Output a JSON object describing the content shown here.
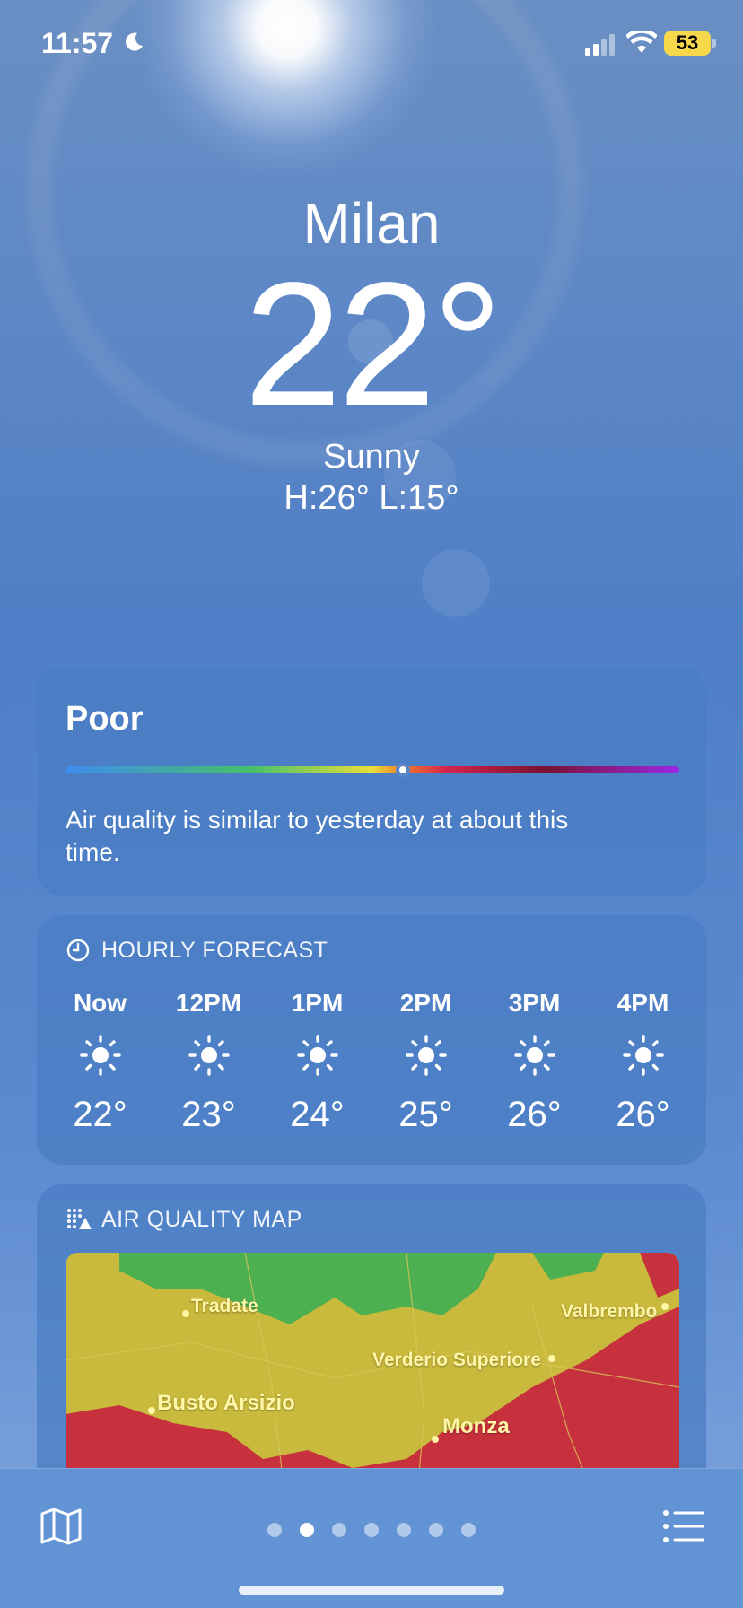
{
  "status_bar": {
    "time": "11:57",
    "battery": "53"
  },
  "location": {
    "city": "Milan",
    "temperature": "22°",
    "condition": "Sunny",
    "high_low": "H:26°  L:15°"
  },
  "air_quality": {
    "level": "Poor",
    "description": "Air quality is similar to yesterday at about this time.",
    "scale_position": 0.55
  },
  "hourly_forecast": {
    "title": "HOURLY FORECAST",
    "hours": [
      {
        "label": "Now",
        "icon": "sun-icon",
        "temp": "22°"
      },
      {
        "label": "12PM",
        "icon": "sun-icon",
        "temp": "23°"
      },
      {
        "label": "1PM",
        "icon": "sun-icon",
        "temp": "24°"
      },
      {
        "label": "2PM",
        "icon": "sun-icon",
        "temp": "25°"
      },
      {
        "label": "3PM",
        "icon": "sun-icon",
        "temp": "26°"
      },
      {
        "label": "4PM",
        "icon": "sun-icon",
        "temp": "26°"
      }
    ]
  },
  "air_quality_map": {
    "title": "AIR QUALITY MAP",
    "places": [
      "Tradate",
      "Valbrembo",
      "Verderio Superiore",
      "Busto Arsizio",
      "Monza"
    ],
    "colors": {
      "good": "#4caf50",
      "moderate": "#c9b93c",
      "poor": "#c7313d"
    }
  },
  "tab_bar": {
    "page_count": 7,
    "active_page": 2
  },
  "colors": {
    "battery": "#f6d84a",
    "card": "#4a7dc4"
  }
}
